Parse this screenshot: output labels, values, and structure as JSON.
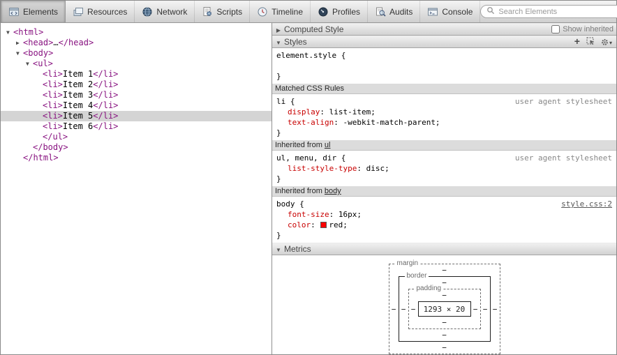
{
  "toolbar": {
    "tabs": [
      {
        "label": "Elements",
        "icon": "elements-icon",
        "selected": true
      },
      {
        "label": "Resources",
        "icon": "resources-icon",
        "selected": false
      },
      {
        "label": "Network",
        "icon": "network-icon",
        "selected": false
      },
      {
        "label": "Scripts",
        "icon": "scripts-icon",
        "selected": false
      },
      {
        "label": "Timeline",
        "icon": "timeline-icon",
        "selected": false
      },
      {
        "label": "Profiles",
        "icon": "profiles-icon",
        "selected": false
      },
      {
        "label": "Audits",
        "icon": "audits-icon",
        "selected": false
      },
      {
        "label": "Console",
        "icon": "console-icon",
        "selected": false
      }
    ],
    "search": {
      "placeholder": "Search Elements"
    }
  },
  "dom_tree": {
    "lines": [
      {
        "indent": 0,
        "arrow": "▼",
        "selected": false,
        "segments": [
          {
            "type": "tag",
            "text": "<html>"
          }
        ]
      },
      {
        "indent": 1,
        "arrow": "▶",
        "selected": false,
        "segments": [
          {
            "type": "tag",
            "text": "<head>"
          },
          {
            "type": "ellipsis",
            "text": "…"
          },
          {
            "type": "tag",
            "text": "</head>"
          }
        ]
      },
      {
        "indent": 1,
        "arrow": "▼",
        "selected": false,
        "segments": [
          {
            "type": "tag",
            "text": "<body>"
          }
        ]
      },
      {
        "indent": 2,
        "arrow": "▼",
        "selected": false,
        "segments": [
          {
            "type": "tag",
            "text": "<ul>"
          }
        ]
      },
      {
        "indent": 3,
        "arrow": null,
        "selected": false,
        "segments": [
          {
            "type": "tag",
            "text": "<li>"
          },
          {
            "type": "text",
            "text": "Item 1"
          },
          {
            "type": "tag",
            "text": "</li>"
          }
        ]
      },
      {
        "indent": 3,
        "arrow": null,
        "selected": false,
        "segments": [
          {
            "type": "tag",
            "text": "<li>"
          },
          {
            "type": "text",
            "text": "Item 2"
          },
          {
            "type": "tag",
            "text": "</li>"
          }
        ]
      },
      {
        "indent": 3,
        "arrow": null,
        "selected": false,
        "segments": [
          {
            "type": "tag",
            "text": "<li>"
          },
          {
            "type": "text",
            "text": "Item 3"
          },
          {
            "type": "tag",
            "text": "</li>"
          }
        ]
      },
      {
        "indent": 3,
        "arrow": null,
        "selected": false,
        "segments": [
          {
            "type": "tag",
            "text": "<li>"
          },
          {
            "type": "text",
            "text": "Item 4"
          },
          {
            "type": "tag",
            "text": "</li>"
          }
        ]
      },
      {
        "indent": 3,
        "arrow": null,
        "selected": true,
        "segments": [
          {
            "type": "tag",
            "text": "<li>"
          },
          {
            "type": "text",
            "text": "Item 5"
          },
          {
            "type": "tag",
            "text": "</li>"
          }
        ]
      },
      {
        "indent": 3,
        "arrow": null,
        "selected": false,
        "segments": [
          {
            "type": "tag",
            "text": "<li>"
          },
          {
            "type": "text",
            "text": "Item 6"
          },
          {
            "type": "tag",
            "text": "</li>"
          }
        ]
      },
      {
        "indent": 3,
        "arrow": null,
        "selected": false,
        "segments": [
          {
            "type": "tag",
            "text": "</ul>"
          }
        ]
      },
      {
        "indent": 2,
        "arrow": null,
        "selected": false,
        "segments": [
          {
            "type": "tag",
            "text": "</body>"
          }
        ]
      },
      {
        "indent": 1,
        "arrow": null,
        "selected": false,
        "segments": [
          {
            "type": "tag",
            "text": "</html>"
          }
        ]
      }
    ]
  },
  "styles_panel": {
    "computed_title": "Computed Style",
    "show_inherited_label": "Show inherited",
    "styles_title": "Styles",
    "element_style": {
      "selector": "element.style {",
      "close": "}"
    },
    "sections": [
      {
        "header_prefix": "Matched CSS Rules",
        "header_link": null,
        "rules": [
          {
            "selector": "li {",
            "origin": "user agent stylesheet",
            "origin_link": false,
            "close": "}",
            "props": [
              {
                "name": "display",
                "value": "list-item;"
              },
              {
                "name": "text-align",
                "value": "-webkit-match-parent;"
              }
            ]
          }
        ]
      },
      {
        "header_prefix": "Inherited from ",
        "header_link": "ul",
        "rules": [
          {
            "selector": "ul, menu, dir {",
            "origin": "user agent stylesheet",
            "origin_link": false,
            "close": "}",
            "props": [
              {
                "name": "list-style-type",
                "value": "disc;"
              }
            ]
          }
        ]
      },
      {
        "header_prefix": "Inherited from ",
        "header_link": "body",
        "rules": [
          {
            "selector": "body {",
            "origin": "style.css:2",
            "origin_link": true,
            "close": "}",
            "props": [
              {
                "name": "font-size",
                "value": "16px;"
              },
              {
                "name": "color",
                "value": "red;",
                "swatch": "#ff0000"
              }
            ]
          }
        ]
      }
    ],
    "metrics": {
      "title": "Metrics",
      "margin_label": "margin",
      "border_label": "border",
      "padding_label": "padding",
      "dash": "−",
      "content": "1293 × 20"
    }
  },
  "colors": {
    "tag_purple": "#881280",
    "property_name_red": "#c80000",
    "selection_background": "#d4d4d4",
    "swatch_red": "#ff0000"
  }
}
